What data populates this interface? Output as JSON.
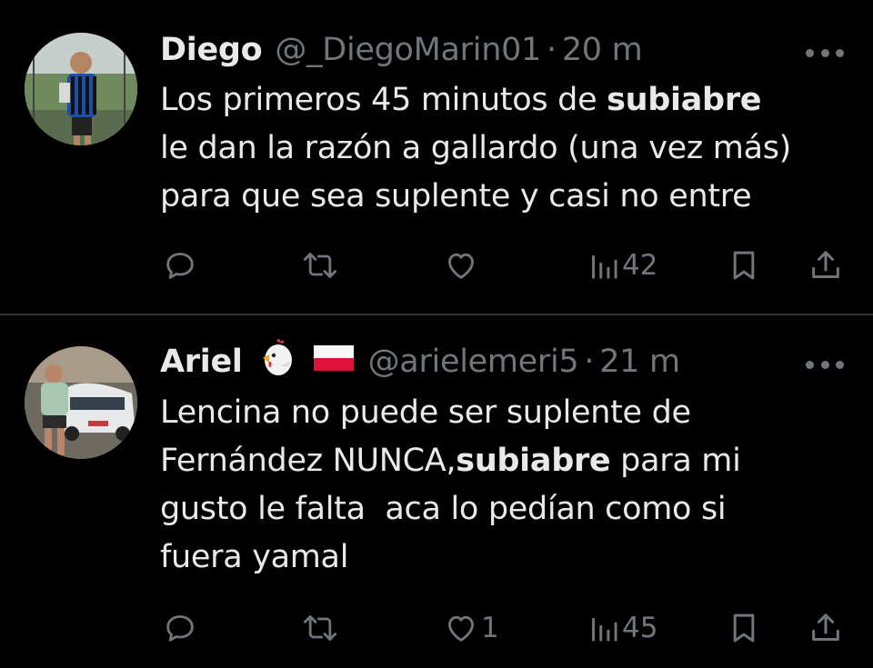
{
  "tweets": [
    {
      "name": "Diego",
      "handle": "@_DiegoMarin01",
      "time": "20 m",
      "text": {
        "l1_pre": "Los primeros 45 minutos de ",
        "l1_bold": "subiabre",
        "l2": "le dan la razón a gallardo (una vez más)",
        "l3": "para que sea suplente y casi no entre"
      },
      "likes": "",
      "views": "42"
    },
    {
      "name": "Ariel",
      "name_emojis": [
        "chicken",
        "poland-flag"
      ],
      "handle": "@arielemeri5",
      "time": "21 m",
      "text": {
        "l1": "Lencina no puede ser suplente de",
        "l2_pre": "Fernández NUNCA,",
        "l2_bold": "subiabre",
        "l2_post": " para mi",
        "l3": "gusto le falta  aca lo pedían como si",
        "l4": "fuera yamal"
      },
      "likes": "1",
      "views": "45"
    }
  ],
  "separator": "·",
  "icons": {
    "reply": "reply-icon",
    "retweet": "retweet-icon",
    "like": "like-icon",
    "views": "views-icon",
    "bookmark": "bookmark-icon",
    "share": "share-icon",
    "more": "more-icon"
  },
  "colors": {
    "background": "#000000",
    "text_primary": "#e7e9ea",
    "text_secondary": "#71767b",
    "divider": "#2f3336"
  }
}
